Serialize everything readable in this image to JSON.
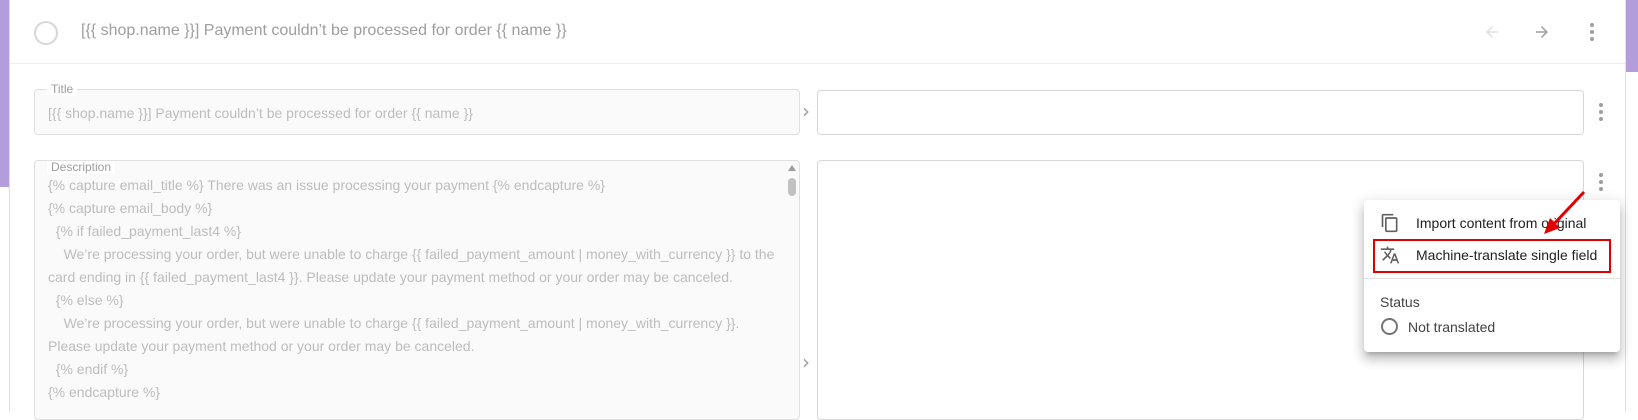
{
  "header": {
    "title": "[{{ shop.name }}] Payment couldn’t be processed for order {{ name }}",
    "prev_icon": "arrow-left-icon",
    "next_icon": "arrow-right-icon",
    "more_icon": "more-vertical-icon"
  },
  "fields": {
    "title": {
      "legend": "Title",
      "value": "[{{ shop.name }}] Payment couldn’t be processed for order {{ name }}",
      "translation": ""
    },
    "description": {
      "legend": "Description",
      "value": "{% capture email_title %} There was an issue processing your payment {% endcapture %}\n{% capture email_body %}\n  {% if failed_payment_last4 %}\n    We’re processing your order, but were unable to charge {{ failed_payment_amount | money_with_currency }} to the card ending in {{ failed_payment_last4 }}. Please update your payment method or your order may be canceled.\n  {% else %}\n    We’re processing your order, but were unable to charge {{ failed_payment_amount | money_with_currency }}. Please update your payment method or your order may be canceled.\n  {% endif %}\n{% endcapture %}",
      "translation": ""
    }
  },
  "context_menu": {
    "items": [
      {
        "label": "Import content from original",
        "icon": "copy-icon"
      },
      {
        "label": "Machine-translate single field",
        "icon": "translate-icon"
      }
    ],
    "status": {
      "heading": "Status",
      "value": "Not translated"
    }
  },
  "colors": {
    "accent": "#b39ddb",
    "highlight": "#e00000"
  }
}
